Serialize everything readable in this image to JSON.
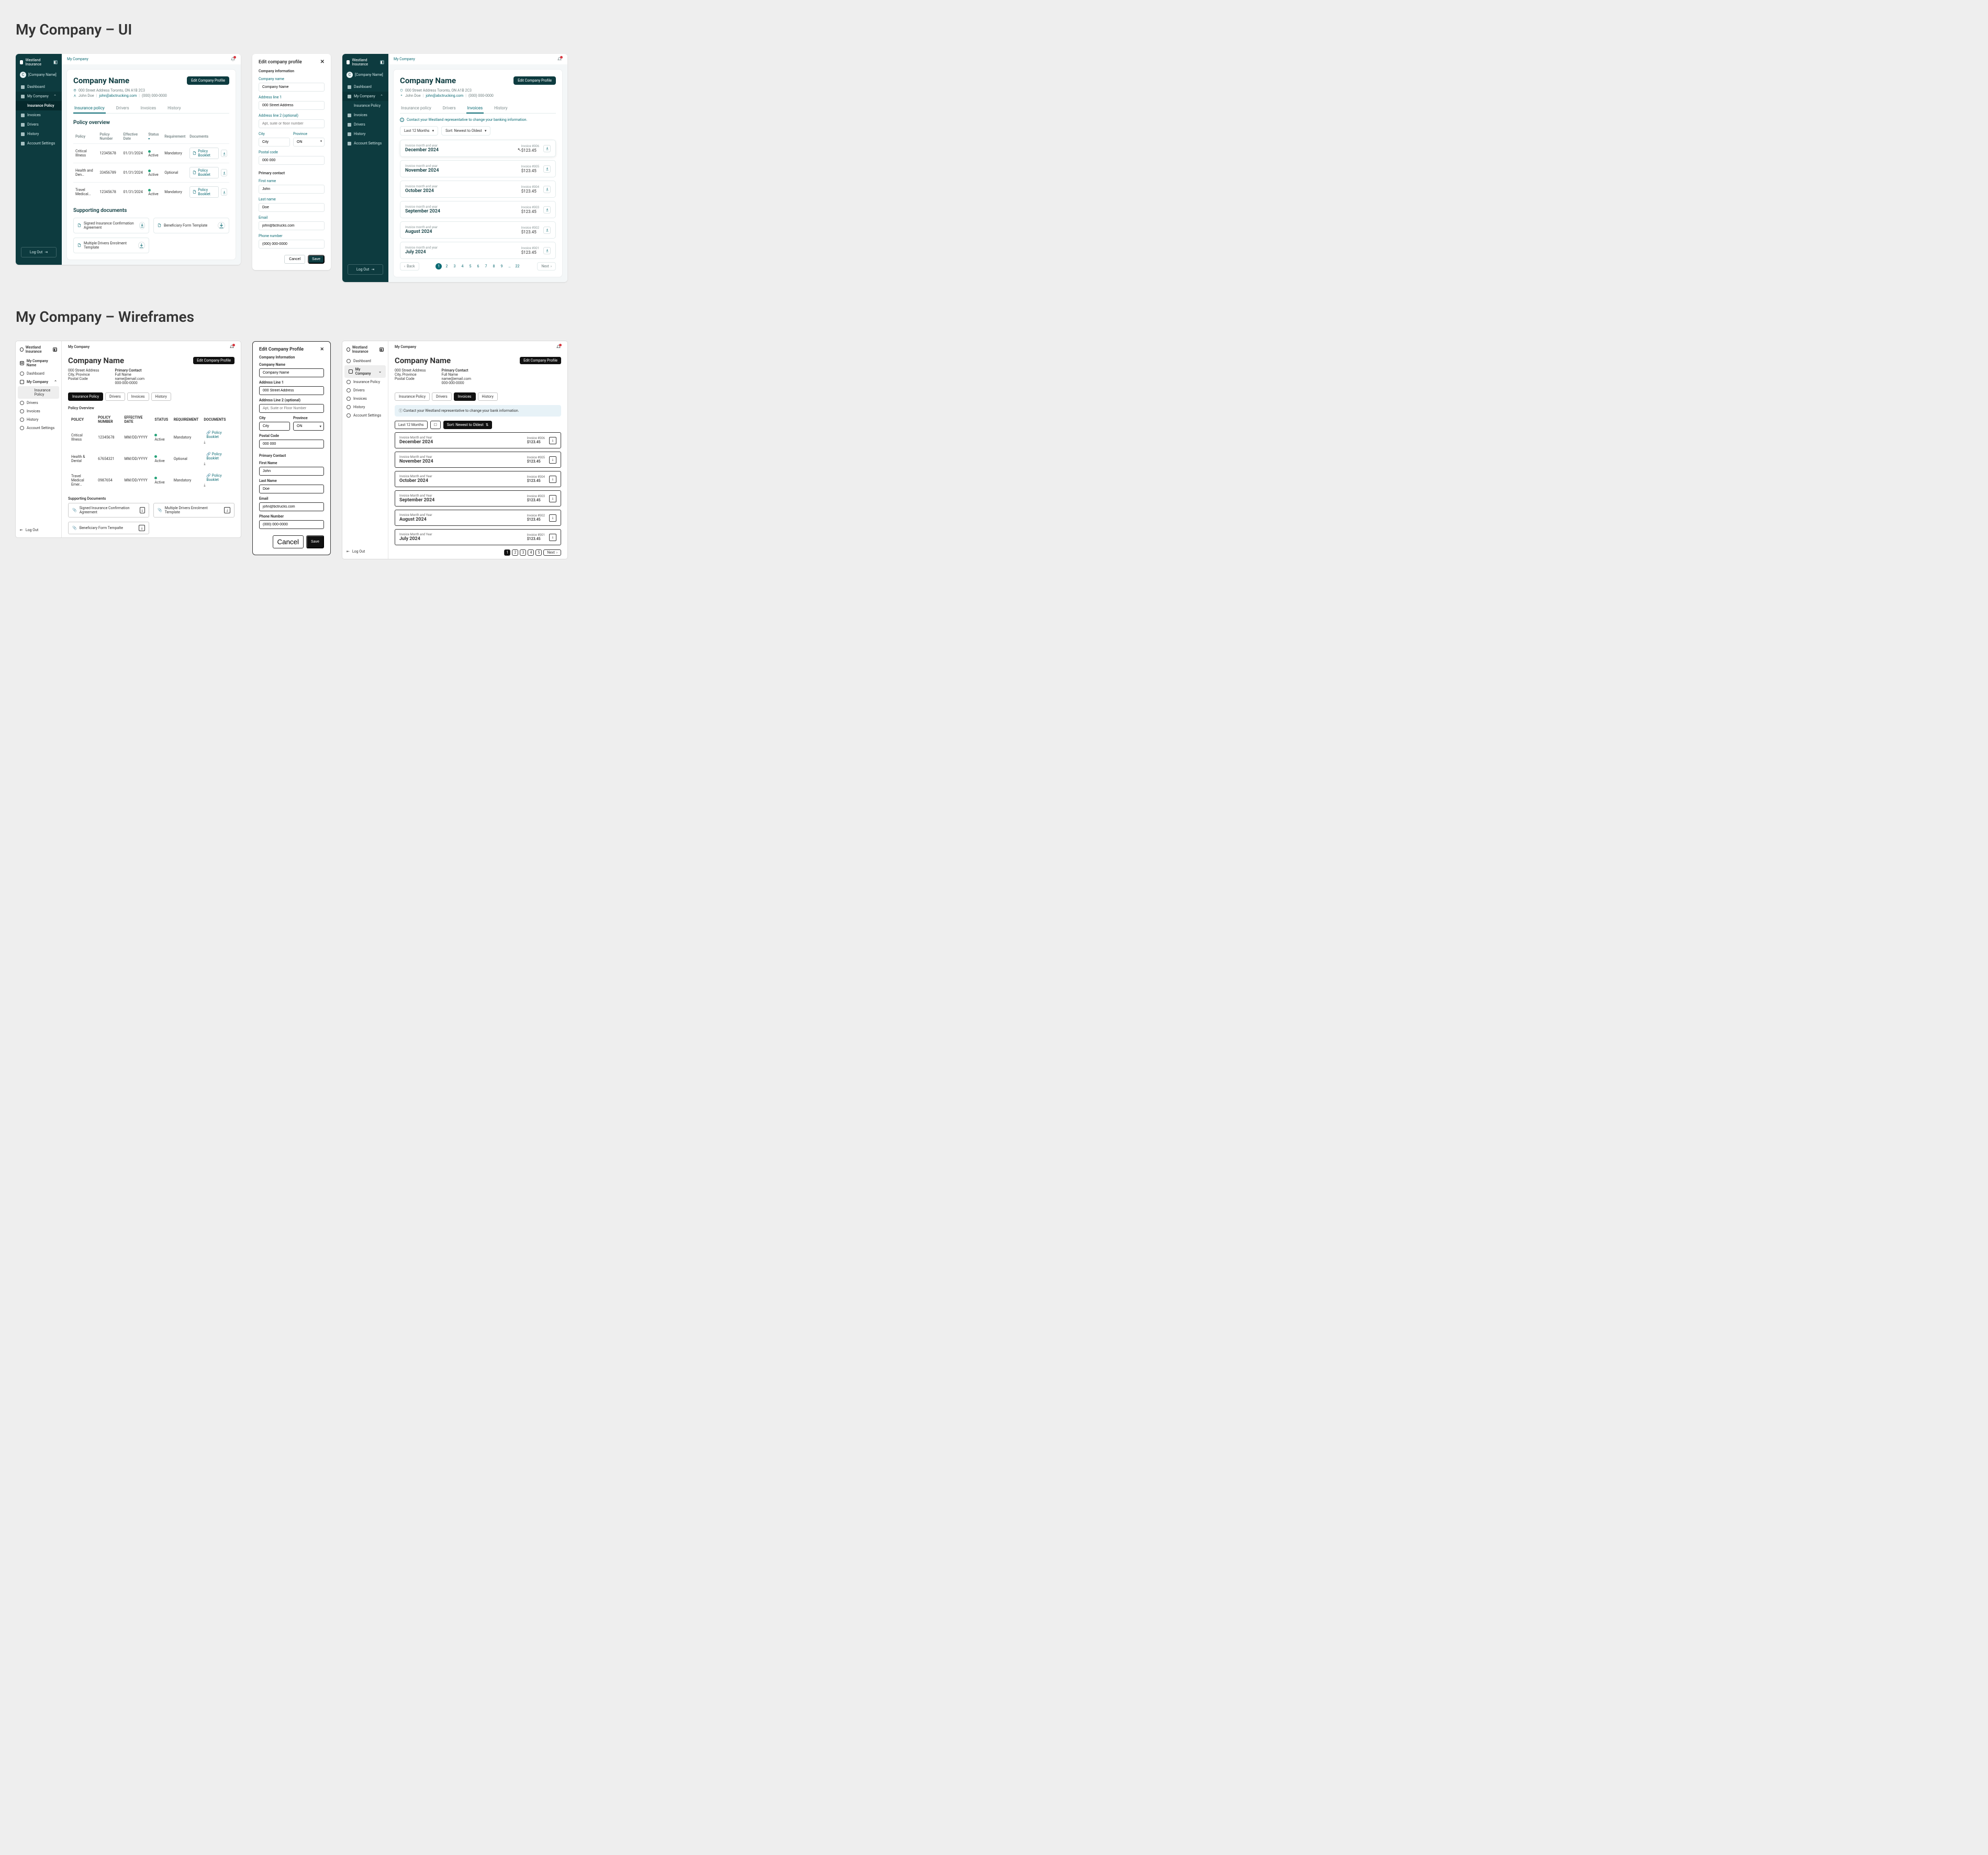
{
  "sections": {
    "ui_title": "My Company – UI",
    "wf_title": "My Company – Wireframes"
  },
  "app": {
    "brand": "Westland Insurance",
    "breadcrumb": "My Company",
    "notif_count": "1",
    "company_chip": {
      "initial": "C",
      "label": "[Company Name]"
    },
    "company_chip_wf": {
      "initial": "M",
      "label": "My Company Name"
    },
    "nav": {
      "dashboard": "Dashboard",
      "my_company": "My Company",
      "insurance_policy": "Insurance Policy",
      "invoices": "Invoices",
      "drivers": "Drivers",
      "history": "History",
      "account_settings": "Account Settings",
      "logout": "Log Out"
    },
    "page": {
      "title": "Company Name",
      "edit_btn": "Edit Company Profile",
      "address": "000 Street Address Toronto, ON A1B 2C3",
      "contact_name": "John Doe",
      "contact_email": "john@abctrucking.com",
      "contact_phone": "(000) 000-0000"
    },
    "tabs": {
      "policy": "Insurance policy",
      "drivers": "Drivers",
      "invoices": "Invoices",
      "history": "History"
    },
    "policy": {
      "heading": "Policy overview",
      "columns": {
        "policy": "Policy",
        "policy_number": "Policy Number",
        "effective_date": "Effective Date",
        "status": "Status",
        "requirement": "Requirement",
        "documents": "Documents"
      },
      "booklet_btn": "Policy Booklet",
      "rows": [
        {
          "name": "Critical Illness",
          "num": "12345678",
          "date": "01/31/2024",
          "status": "Active",
          "req": "Mandatory"
        },
        {
          "name": "Health and Den…",
          "num": "33456789",
          "date": "01/31/2024",
          "status": "Active",
          "req": "Optional"
        },
        {
          "name": "Travel Medical…",
          "num": "12345678",
          "date": "01/31/2024",
          "status": "Active",
          "req": "Mandatory"
        }
      ],
      "docs_heading": "Supporting documents",
      "docs": [
        "Signed Insurance Confirmation Agreement",
        "Beneficiary Form Template",
        "Multiple Drivers Enrolment Template"
      ]
    },
    "invoices": {
      "banner": "Contact your Westland representative to change your banking information.",
      "filter_range": "Last 12 Months",
      "filter_sort": "Sort: Newest to Oldest",
      "row_label": "Invoice month and year",
      "rows": [
        {
          "month": "December 2024",
          "num": "Invoice #006",
          "amt": "$123.45"
        },
        {
          "month": "November 2024",
          "num": "Invoice #005",
          "amt": "$123.45"
        },
        {
          "month": "October 2024",
          "num": "Invoice #004",
          "amt": "$123.45"
        },
        {
          "month": "September 2024",
          "num": "Invoice #003",
          "amt": "$123.45"
        },
        {
          "month": "August 2024",
          "num": "Invoice #002",
          "amt": "$123.45"
        },
        {
          "month": "July 2024",
          "num": "Invoice #001",
          "amt": "$123.45"
        }
      ],
      "pager_back": "Back",
      "pager_next": "Next",
      "pages": [
        "1",
        "2",
        "3",
        "4",
        "5",
        "6",
        "7",
        "8",
        "9",
        "…",
        "22"
      ]
    }
  },
  "edit": {
    "title": "Edit company profile",
    "section_info": "Company information",
    "company_name": "Company name",
    "company_name_val": "Company Name",
    "addr1": "Address line 1",
    "addr1_val": "000 Street Address",
    "addr2": "Address line 2 (optional)",
    "addr2_ph": "Apt, suite or floor number",
    "city": "City",
    "city_val": "City",
    "province": "Province",
    "province_val": "ON",
    "postal": "Postal code",
    "postal_val": "000 000",
    "section_contact": "Primary contact",
    "first": "First name",
    "first_val": "John",
    "last": "Last name",
    "last_val": "Doe",
    "email": "Email",
    "email_val": "john@bctrucks.com",
    "phone": "Phone number",
    "phone_val": "(000) 000-0000",
    "cancel": "Cancel",
    "save": "Save"
  },
  "wf": {
    "edit": {
      "title": "Edit Company Profile",
      "section_info": "Company Information",
      "company_name": "Company Name",
      "company_name_val": "Company Name",
      "addr1": "Address Line 1",
      "addr1_val": "000 Street Address",
      "addr2": "Address Line 2 (optional)",
      "addr2_ph": "Apt, Suite or Floor Number",
      "city": "City",
      "city_val": "City",
      "province": "Province",
      "province_val": "ON",
      "postal": "Postal Code",
      "postal_val": "000 000",
      "section_contact": "Primary Contact",
      "first": "First Name",
      "first_val": "John",
      "last": "Last Name",
      "last_val": "Doe",
      "email": "Email",
      "email_val": "john@bctrucks.com",
      "phone": "Phone Number",
      "phone_val": "(000) 000-0000"
    },
    "page": {
      "address_l1": "000 Street Address",
      "address_l2": "City, Province",
      "address_l3": "Postal Code",
      "contact_label": "Primary Contact",
      "contact_name": "Full Name",
      "contact_email": "name@email.com",
      "contact_phone": "000-000-0000"
    },
    "tabs": {
      "policy": "Insurance Policy",
      "drivers": "Drivers",
      "invoices": "Invoices",
      "history": "History"
    },
    "policy": {
      "heading": "Policy Overview",
      "cols": {
        "policy": "POLICY",
        "num": "POLICY NUMBER",
        "date": "EFFECTIVE DATE",
        "status": "STATUS",
        "req": "REQUIREMENT",
        "docs": "DOCUMENTS"
      },
      "rows": [
        {
          "name": "Critical Illness",
          "num": "12345678",
          "date": "MM/DD/YYYY",
          "status": "Active",
          "req": "Mandatory"
        },
        {
          "name": "Health & Dental",
          "num": "67654321",
          "date": "MM/DD/YYYY",
          "status": "Active",
          "req": "Optional"
        },
        {
          "name": "Travel Medical Emer…",
          "num": "0987654",
          "date": "MM/DD/YYYY",
          "status": "Active",
          "req": "Mandatory"
        }
      ],
      "docs_heading": "Supporting Documents",
      "docs": [
        "Signed Insurance Confirmation Agreement",
        "Multiple Drivers Enrolment Template",
        "Beneficiary Form Tempalte"
      ]
    },
    "invoices": {
      "banner": "Contact your Westland representative to change your bank information.",
      "range": "Last 12 Months",
      "sort": "Sort: Newest to Oldest",
      "row_label": "Invoice Month and Year",
      "rows": [
        {
          "month": "December 2024",
          "num": "Invoice #006",
          "amt": "$123.45"
        },
        {
          "month": "November 2024",
          "num": "Invoice #005",
          "amt": "$123.45"
        },
        {
          "month": "October 2024",
          "num": "Invoice #004",
          "amt": "$123.45"
        },
        {
          "month": "September 2024",
          "num": "Invoice #003",
          "amt": "$123.45"
        },
        {
          "month": "August 2024",
          "num": "Invoice #002",
          "amt": "$123.45"
        },
        {
          "month": "July 2024",
          "num": "Invoice #001",
          "amt": "$123.45"
        }
      ],
      "pages": [
        "1",
        "2",
        "3",
        "4",
        "5"
      ],
      "next": "Next"
    }
  }
}
